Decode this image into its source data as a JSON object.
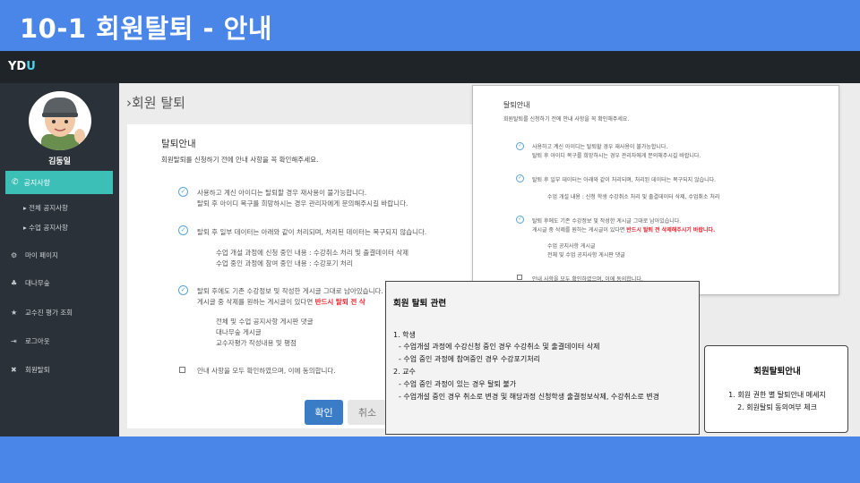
{
  "slide": {
    "title": "10-1 회원탈퇴 - 안내"
  },
  "app": {
    "logo_main": "YD",
    "logo_accent": "U"
  },
  "sidebar": {
    "user_name": "김동일",
    "active_item": "공지사항",
    "sub_items": [
      "전체 공지사항",
      "수업 공지사항"
    ],
    "items": [
      "마이 페이지",
      "대나무숲",
      "교수진 평가 조회",
      "로그아웃",
      "회원탈퇴"
    ]
  },
  "main": {
    "page_title": "›회원 탈퇴",
    "card_heading": "탈퇴안내",
    "intro": "회원탈퇴를 신청하기 전에 안내 사항을 꼭 확인해주세요.",
    "notices": [
      {
        "line1": "사용하고 계신 아이디는 탈퇴할 경우 재사용이 불가능합니다.",
        "line2": "탈퇴 후 아이디 복구를 희망하시는 경우 관리자에게 문의해주시길 바랍니다."
      },
      {
        "line1": "탈퇴 후 일부 데이터는 아래와 같이 처리되며, 처리된 데이터는 복구되지 않습니다."
      },
      {
        "line1": "탈퇴 후에도 기존 수강정보 및 작성한 게시글 그대로 남아있습니다.",
        "line2_prefix": "게시글 중 삭제를 원하는 게시글이 있다면 ",
        "line2_emph": "반드시 탈퇴 전 삭"
      }
    ],
    "data_items": [
      "수업 개설 과정에 신청 중인 내용 : 수강취소 처리 및 출결데이터 삭제",
      "수업 중인 과정에 참여 중인 내용 : 수강포기 처리"
    ],
    "post_items": [
      "전체 및 수업 공지사항 게시판 댓글",
      "대나무숲 게시글",
      "교수자평가 작성내용 및 평점"
    ],
    "agree_label": "안내 사항을 모두 확인하였으며, 이에 동의합니다.",
    "confirm_button": "확인",
    "cancel_button": "취소"
  },
  "professor_view": {
    "heading": "탈퇴안내",
    "intro": "회원탈퇴를 신청하기 전에 안내 사항을 꼭 확인해주세요.",
    "n1_line1": "사용하고 계신 아이디는 탈퇴할 경우 재사용이 불가능합니다.",
    "n1_line2": "탈퇴 후 아이디 복구를 희망하시는 경우 관리자에게 문의해주시길 바랍니다.",
    "n2_line1": "탈퇴 후 일부 데이터는 아래와 같이 처리되며, 처리된 데이터는 복구되지 않습니다.",
    "n2_item": "수업 개설 내용 : 신청 학생 수강취소 처리 및 출결데이터 삭제, 수업취소 처리",
    "n3_line1": "탈퇴 후에도 기존 수강정보 및 작성한 게시글 그대로 남아있습니다.",
    "n3_line2_prefix": "게시글 중 삭제를 원하는 게시글이 있다면 ",
    "n3_line2_emph": "반드시 탈퇴 전 삭제해주시기 바랍니다.",
    "post_items": [
      "수업 공지사항 게시글",
      "전체 및 수업 공지사항 게시판 댓글"
    ],
    "agree_partial": "안내 사항을 모두 확인하였으며, 이에 동의합니다."
  },
  "note_withdrawal": {
    "title": "회원 탈퇴 관련",
    "lines": [
      "1. 학생",
      "- 수업개설 과정에 수강신청 중인 경우 수강취소 및 출결데이터 삭제",
      "- 수업 중인 과정에 참여중인 경우 수강포기처리",
      "2. 교수",
      "- 수업 중인 과정이 있는 경우 탈퇴 불가",
      "- 수업개설 중인 경우 취소로 변경 및 해당과정 신청학생 출결정보삭제, 수강취소로 변경"
    ]
  },
  "note_guide": {
    "title": "회원탈퇴안내",
    "lines": [
      "1. 회원 권한 별 탈퇴안내 메세지",
      "2. 회원탈퇴 동의여부 체크"
    ]
  }
}
